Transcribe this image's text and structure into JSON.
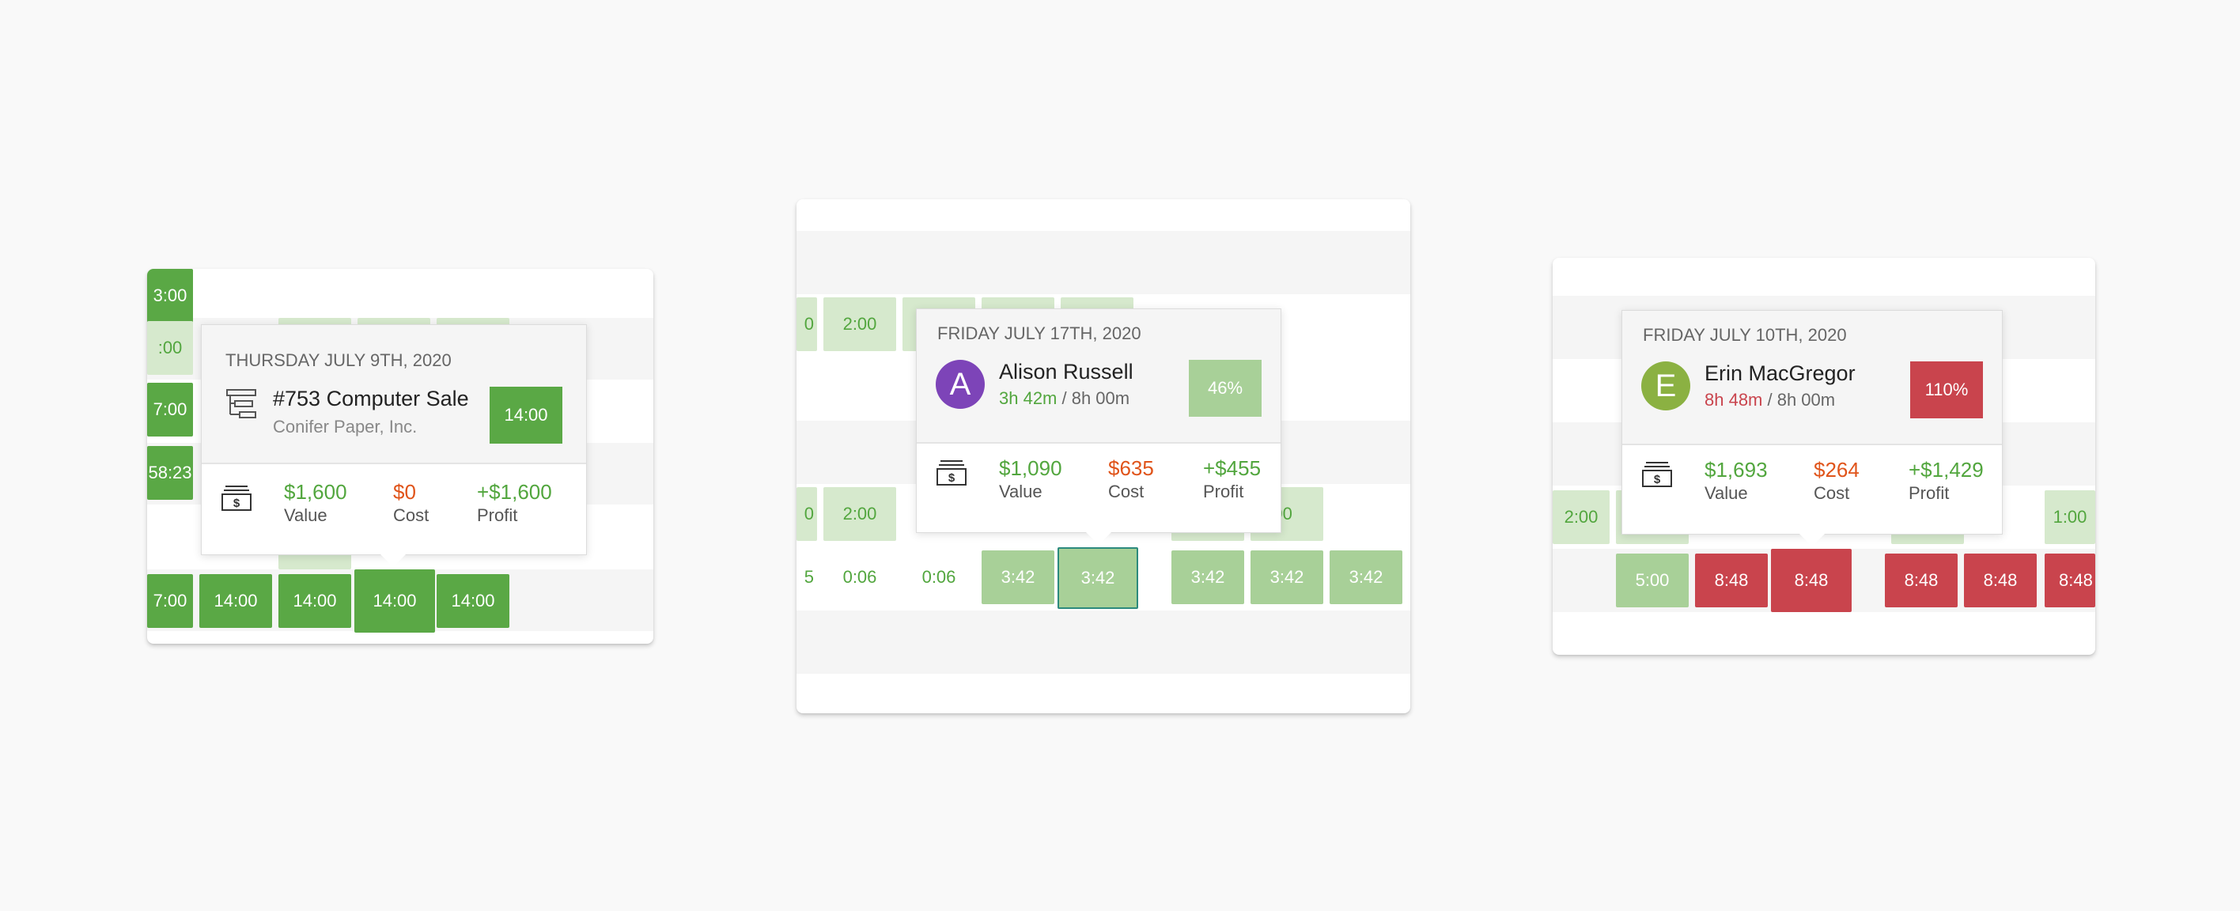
{
  "colors": {
    "background": "#f9f9f9",
    "green": "#5aa845",
    "light_green": "#a8d098",
    "faded_green": "#d6e9cd",
    "red": "#c9444d",
    "orange": "#e0541a",
    "avatar_purple": "#7d44b8",
    "avatar_olive": "#8bb142",
    "selected_border": "#2c8a7d"
  },
  "panel1": {
    "cells": {
      "r0": "3:00",
      "r1": ":00",
      "r2": "7:00",
      "r3": "58:23",
      "r5a": "7:00",
      "r5b": "14:00",
      "r5c": "14:00",
      "r5d": "14:00",
      "r5e": "14:00"
    },
    "tooltip": {
      "date": "THURSDAY JULY 9TH, 2020",
      "icon": "task-list-icon",
      "title": "#753 Computer Sale",
      "subtitle": "Conifer Paper, Inc.",
      "badge": "14:00",
      "money_icon": "cash-icon",
      "value": "$1,600",
      "value_label": "Value",
      "cost": "$0",
      "cost_label": "Cost",
      "profit": "+$1,600",
      "profit_label": "Profit"
    }
  },
  "panel2": {
    "cells": {
      "r1a": "0",
      "r1b": "2:00",
      "r3a": "0",
      "r3b": "2:00",
      "r3c": "2:00",
      "r4a": "5",
      "r4b": "0:06",
      "r4c": "0:06",
      "r4d": "3:42",
      "r4e": "3:42",
      "r4f": "3:42",
      "r4g": "3:42",
      "r4h": "3:42"
    },
    "tooltip": {
      "date": "FRIDAY JULY 17TH, 2020",
      "avatar": "A",
      "name": "Alison Russell",
      "hours_worked": "3h 42m",
      "hours_total": " / 8h 00m",
      "badge": "46%",
      "money_icon": "cash-icon",
      "value": "$1,090",
      "value_label": "Value",
      "cost": "$635",
      "cost_label": "Cost",
      "profit": "+$455",
      "profit_label": "Profit"
    }
  },
  "panel3": {
    "cells": {
      "r3a": "2:00",
      "r3b": "00",
      "r3c": "1:00",
      "r4a": "5:00",
      "r4b": "8:48",
      "r4c": "8:48",
      "r4d": "8:48",
      "r4e": "8:48",
      "r4f": "8:48"
    },
    "tooltip": {
      "date": "FRIDAY JULY 10TH, 2020",
      "avatar": "E",
      "name": "Erin MacGregor",
      "hours_worked": "8h 48m",
      "hours_total": " / 8h 00m",
      "badge": "110%",
      "money_icon": "cash-icon",
      "value": "$1,693",
      "value_label": "Value",
      "cost": "$264",
      "cost_label": "Cost",
      "profit": "+$1,429",
      "profit_label": "Profit"
    }
  }
}
